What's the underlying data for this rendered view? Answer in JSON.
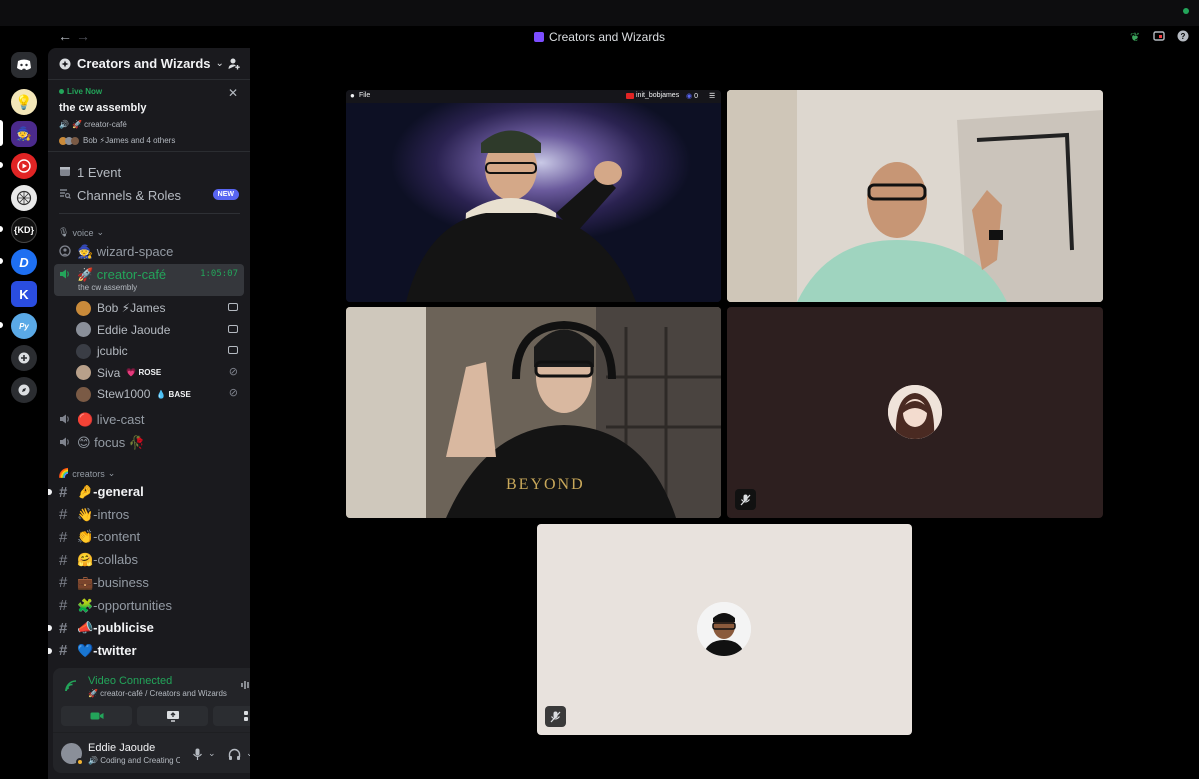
{
  "window": {
    "title": "Creators and Wizards"
  },
  "server": {
    "name": "Creators and Wizards"
  },
  "live": {
    "badge": "Live Now",
    "title": "the cw assembly",
    "channel": "🚀 creator-café",
    "members": "Bob ⚡James and 4 others"
  },
  "shortcuts": {
    "events": "1 Event",
    "channels_roles": "Channels & Roles",
    "new_badge": "NEW"
  },
  "voice_category": "voice",
  "voice_channels": {
    "wizard_space": "🧙 wizard-space",
    "creator_cafe": "🚀 creator-café",
    "creator_cafe_status": "the cw assembly",
    "creator_cafe_timer": "1:05:07",
    "live_cast": "🔴 live-cast",
    "focus": "😊 focus 🥀"
  },
  "voice_users": [
    {
      "name": "Bob ⚡James",
      "tag": "",
      "av": "#c98a3a"
    },
    {
      "name": "Eddie Jaoude",
      "tag": "",
      "av": "#8a8f99"
    },
    {
      "name": "jcubic",
      "tag": "",
      "av": "#3a3d45"
    },
    {
      "name": "Siva",
      "tag": "💗 ROSE",
      "av": "#b8a08a"
    },
    {
      "name": "Stew1000",
      "tag": "💧 BASE",
      "av": "#7a5a45"
    }
  ],
  "creators_category": "creators",
  "text_channels": [
    {
      "label": "🤌-general",
      "bold": true,
      "unread": true
    },
    {
      "label": "👋-intros",
      "bold": false,
      "unread": false
    },
    {
      "label": "👏-content",
      "bold": false,
      "unread": false
    },
    {
      "label": "🤗-collabs",
      "bold": false,
      "unread": false
    },
    {
      "label": "💼-business",
      "bold": false,
      "unread": false
    },
    {
      "label": "🧩-opportunities",
      "bold": false,
      "unread": false
    },
    {
      "label": "📣-publicise",
      "bold": true,
      "unread": true
    },
    {
      "label": "💙-twitter",
      "bold": true,
      "unread": true
    }
  ],
  "connection": {
    "status": "Video Connected",
    "location": "🚀 creator-café / Creators and Wizards"
  },
  "user": {
    "name": "Eddie Jaoude",
    "status": "Coding and Creating C"
  },
  "stream_overlay": {
    "app": "File",
    "recording_user": "init_bobjames",
    "viewer_count": "0"
  },
  "colors": {
    "accent": "#5865f2",
    "connected_green": "#23a55a",
    "sidebar_bg": "#1a1a1e"
  }
}
